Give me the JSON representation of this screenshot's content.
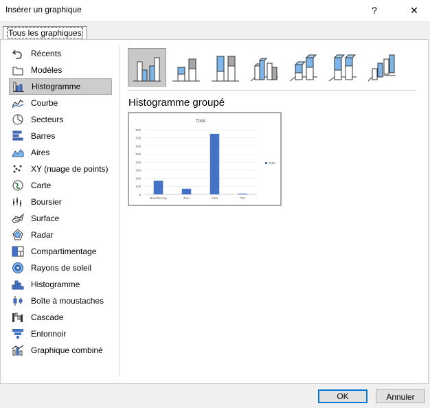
{
  "window": {
    "title": "Insérer un graphique",
    "help": "?",
    "close": "✕"
  },
  "tab": {
    "label": "Tous les graphiques"
  },
  "sidebar": {
    "items": [
      {
        "label": "Récents",
        "icon": "undo-arrow-icon"
      },
      {
        "label": "Modèles",
        "icon": "folder-icon"
      },
      {
        "label": "Histogramme",
        "icon": "column-chart-icon",
        "selected": true
      },
      {
        "label": "Courbe",
        "icon": "line-chart-icon"
      },
      {
        "label": "Secteurs",
        "icon": "pie-chart-icon"
      },
      {
        "label": "Barres",
        "icon": "bar-chart-icon"
      },
      {
        "label": "Aires",
        "icon": "area-chart-icon"
      },
      {
        "label": "XY (nuage de points)",
        "icon": "scatter-chart-icon"
      },
      {
        "label": "Carte",
        "icon": "map-chart-icon"
      },
      {
        "label": "Boursier",
        "icon": "stock-chart-icon"
      },
      {
        "label": "Surface",
        "icon": "surface-chart-icon"
      },
      {
        "label": "Radar",
        "icon": "radar-chart-icon"
      },
      {
        "label": "Compartimentage",
        "icon": "treemap-icon"
      },
      {
        "label": "Rayons de soleil",
        "icon": "sunburst-icon"
      },
      {
        "label": "Histogramme",
        "icon": "histogram-icon"
      },
      {
        "label": "Boîte à moustaches",
        "icon": "box-whisker-icon"
      },
      {
        "label": "Cascade",
        "icon": "waterfall-icon"
      },
      {
        "label": "Entonnoir",
        "icon": "funnel-icon"
      },
      {
        "label": "Graphique combiné",
        "icon": "combo-chart-icon"
      }
    ]
  },
  "main": {
    "subtype_title": "Histogramme groupé"
  },
  "chart_data": {
    "type": "bar",
    "title": "Total",
    "categories": [
      "Band/Group",
      "Duo",
      "Solo",
      "Trio"
    ],
    "series": [
      {
        "name": "Total",
        "values": [
          170,
          70,
          750,
          10
        ]
      }
    ],
    "ylim": [
      0,
      800
    ],
    "yticks": [
      "0",
      "100",
      "200",
      "300",
      "400",
      "500",
      "600",
      "700",
      "800"
    ],
    "grid": true,
    "legend": "right",
    "color": "#4472c4"
  },
  "footer": {
    "ok": "OK",
    "cancel": "Annuler"
  }
}
